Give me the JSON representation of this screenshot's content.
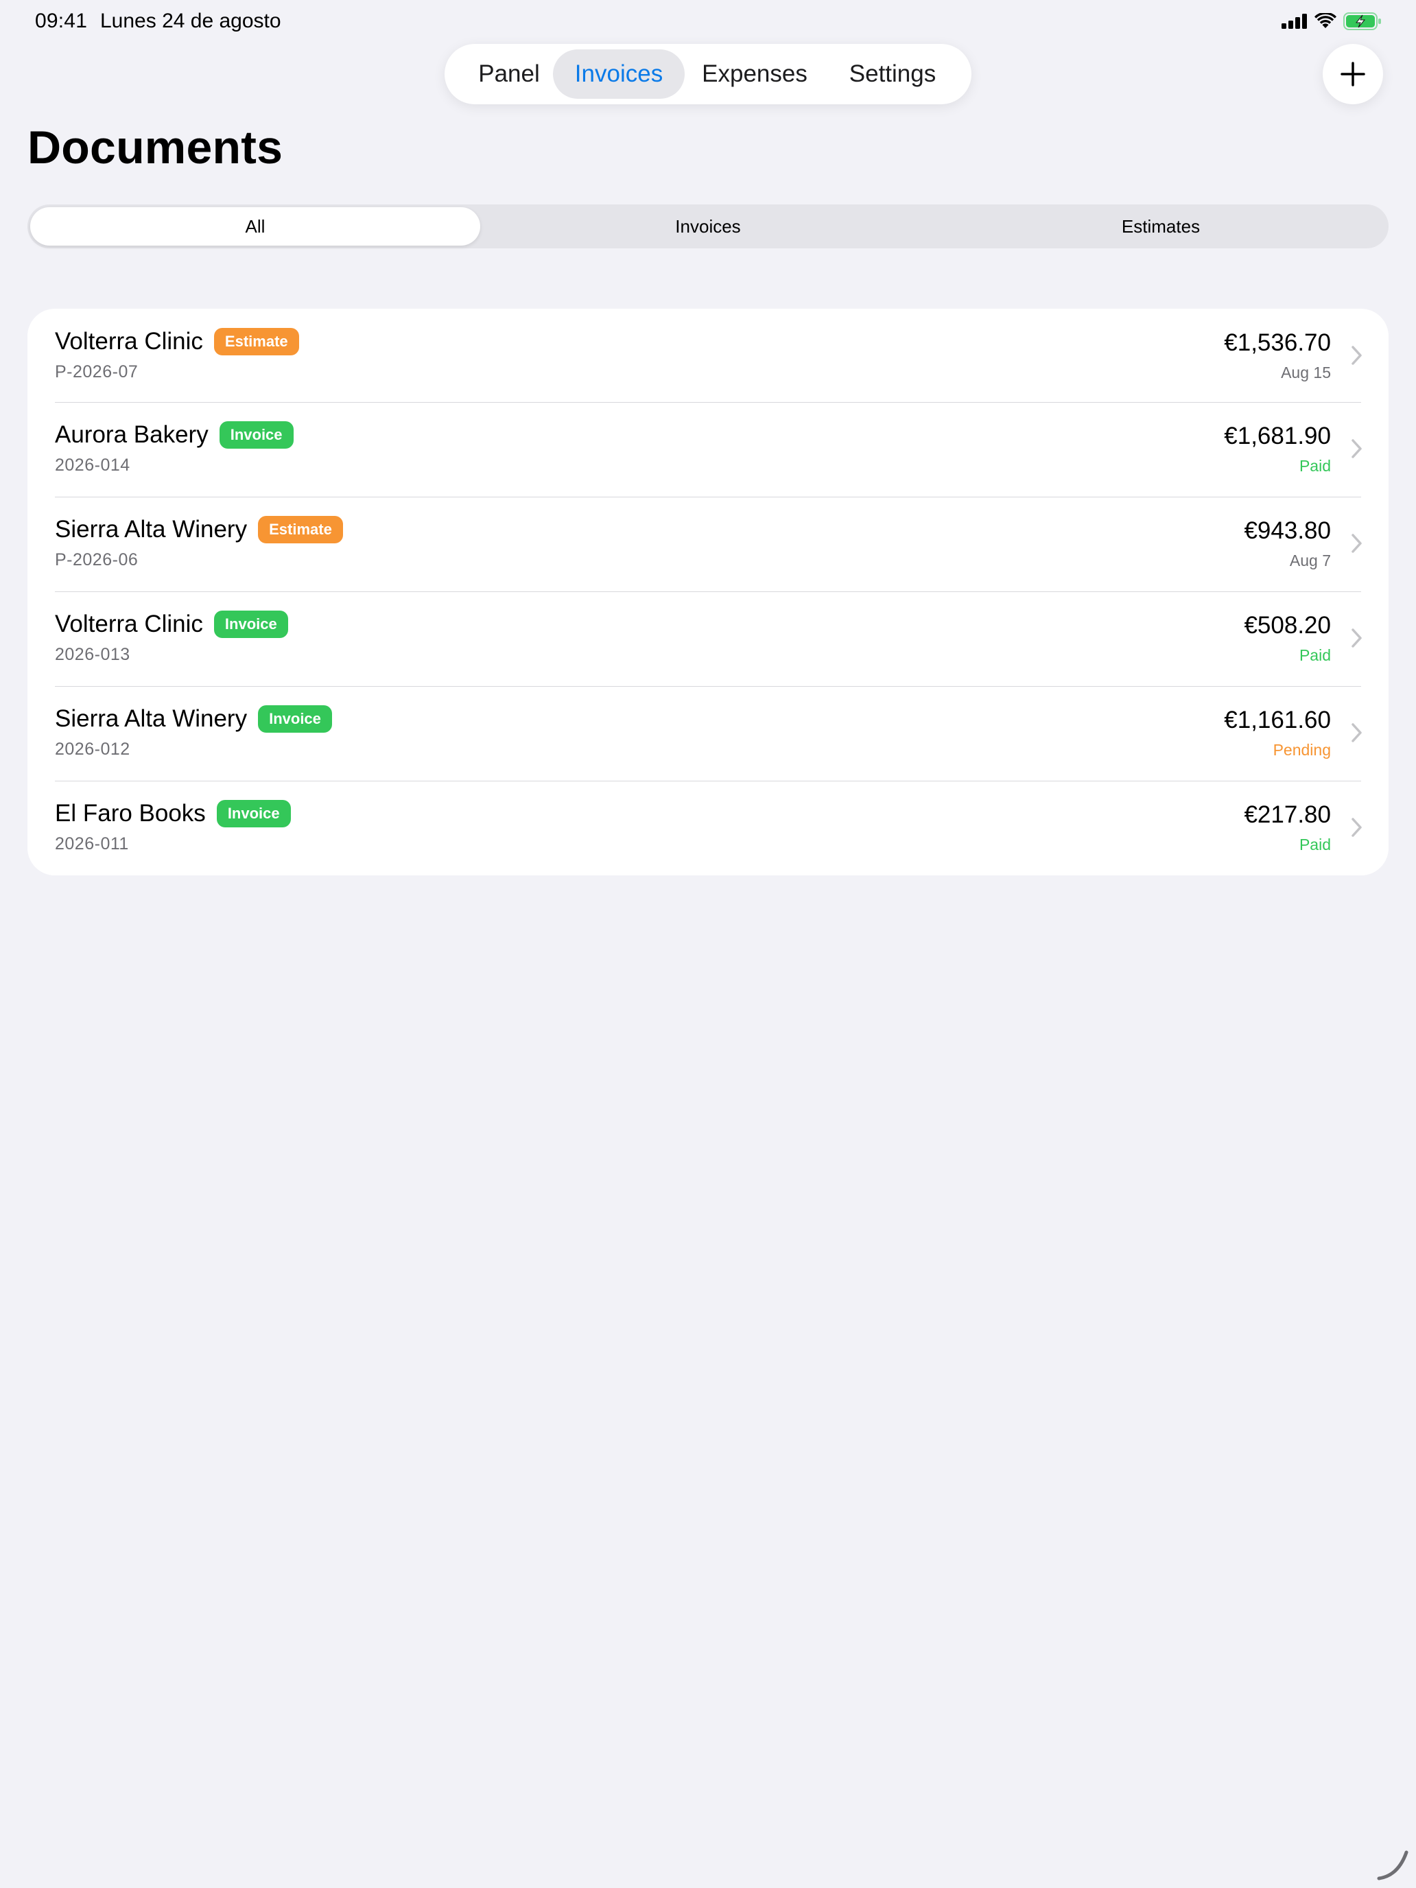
{
  "status_bar": {
    "time": "09:41",
    "date": "Lunes 24 de agosto",
    "icons": [
      "cellular-signal-icon",
      "wifi-icon",
      "battery-charging-icon"
    ]
  },
  "tabs": [
    {
      "label": "Panel",
      "active": false
    },
    {
      "label": "Invoices",
      "active": true
    },
    {
      "label": "Expenses",
      "active": false
    },
    {
      "label": "Settings",
      "active": false
    }
  ],
  "add_button": {
    "icon": "plus-icon"
  },
  "page_title": "Documents",
  "filter": {
    "segments": [
      {
        "label": "All",
        "selected": true
      },
      {
        "label": "Invoices",
        "selected": false
      },
      {
        "label": "Estimates",
        "selected": false
      }
    ]
  },
  "documents": [
    {
      "client": "Volterra Clinic",
      "type": "Estimate",
      "number": "P-2026-07",
      "amount": "€1,536.70",
      "status": "Aug 15",
      "status_kind": "neutral"
    },
    {
      "client": "Aurora Bakery",
      "type": "Invoice",
      "number": "2026-014",
      "amount": "€1,681.90",
      "status": "Paid",
      "status_kind": "paid"
    },
    {
      "client": "Sierra Alta Winery",
      "type": "Estimate",
      "number": "P-2026-06",
      "amount": "€943.80",
      "status": "Aug 7",
      "status_kind": "neutral"
    },
    {
      "client": "Volterra Clinic",
      "type": "Invoice",
      "number": "2026-013",
      "amount": "€508.20",
      "status": "Paid",
      "status_kind": "paid"
    },
    {
      "client": "Sierra Alta Winery",
      "type": "Invoice",
      "number": "2026-012",
      "amount": "€1,161.60",
      "status": "Pending",
      "status_kind": "pending"
    },
    {
      "client": "El Faro Books",
      "type": "Invoice",
      "number": "2026-011",
      "amount": "€217.80",
      "status": "Paid",
      "status_kind": "paid"
    }
  ],
  "colors": {
    "accent": "#0a7ae8",
    "estimate_badge": "#f79533",
    "invoice_badge": "#34c759",
    "paid": "#34c759",
    "pending": "#f79533",
    "background": "#f2f2f7"
  }
}
